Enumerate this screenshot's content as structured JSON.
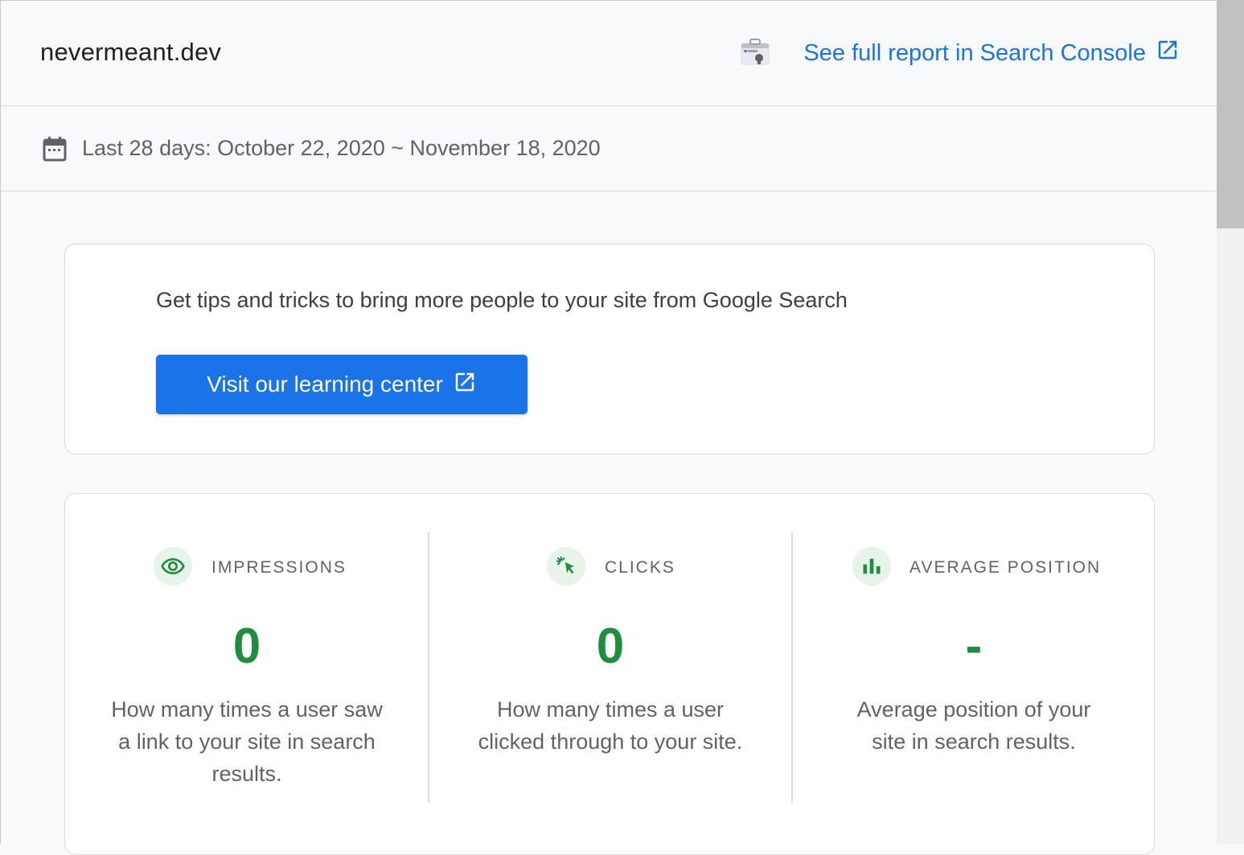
{
  "header": {
    "site_name": "nevermeant.dev",
    "console_link_label": "See full report in Search Console",
    "console_icon": "search-console-icon",
    "external_icon": "open-in-new-icon"
  },
  "date_range": {
    "icon": "calendar-icon",
    "label": "Last 28 days: October 22, 2020 ~ November 18, 2020"
  },
  "tips": {
    "text": "Get tips and tricks to bring more people to your site from Google Search",
    "button_label": "Visit our learning center",
    "button_icon": "open-in-new-icon"
  },
  "metrics": [
    {
      "icon": "eye-icon",
      "title": "IMPRESSIONS",
      "value": "0",
      "description": "How many times a user saw a link to your site in search results."
    },
    {
      "icon": "cursor-click-icon",
      "title": "CLICKS",
      "value": "0",
      "description": "How many times a user clicked through to your site."
    },
    {
      "icon": "bar-chart-icon",
      "title": "AVERAGE POSITION",
      "value": "-",
      "description": "Average position of your site in search results."
    }
  ],
  "colors": {
    "accent": "#1a73e8",
    "metric_value": "#1e8e3e",
    "metric_icon_bg": "#e6f4ea"
  }
}
